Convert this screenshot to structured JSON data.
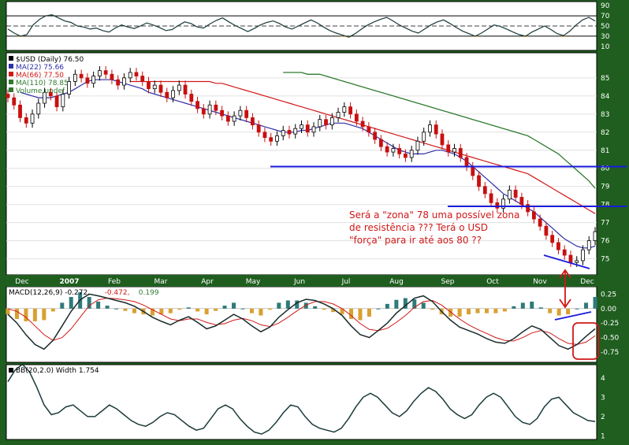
{
  "chart_data": [
    {
      "type": "line",
      "panel": "rsi",
      "y_ticks": [
        10,
        30,
        50,
        70,
        90
      ],
      "levels": [
        30,
        50,
        70
      ],
      "ylim": [
        5,
        95
      ],
      "series": [
        {
          "values": [
            44,
            36,
            30,
            33,
            52,
            63,
            70,
            72,
            66,
            60,
            57,
            50,
            48,
            44,
            46,
            41,
            38,
            46,
            52,
            48,
            45,
            50,
            56,
            52,
            47,
            41,
            43,
            51,
            58,
            55,
            48,
            46,
            54,
            61,
            66,
            58,
            51,
            45,
            39,
            45,
            52,
            57,
            60,
            55,
            48,
            44,
            50,
            56,
            62,
            56,
            48,
            41,
            36,
            32,
            28,
            35,
            44,
            52,
            58,
            63,
            67,
            60,
            52,
            46,
            40,
            36,
            44,
            52,
            58,
            62,
            55,
            47,
            40,
            35,
            30,
            36,
            44,
            52,
            49,
            44,
            38,
            33,
            30,
            38,
            44,
            50,
            43,
            35,
            31,
            40,
            52,
            62,
            67,
            60
          ]
        }
      ]
    },
    {
      "type": "candlestick",
      "panel": "price",
      "legend": [
        {
          "label": "$USD (Daily) 76.50",
          "color": "#000000"
        },
        {
          "label": "MA(22) 75.66",
          "color": "#2f2fa8"
        },
        {
          "label": "MA(66) 77.50",
          "color": "#d01818"
        },
        {
          "label": "MA(110) 78.85",
          "color": "#2f7a2f"
        },
        {
          "label": "Volume undef",
          "color": "#2f7a2f"
        }
      ],
      "y_ticks": [
        75,
        76,
        77,
        78,
        79,
        80,
        81,
        82,
        83,
        84,
        85
      ],
      "ylim": [
        74.2,
        86.3
      ],
      "x_labels": [
        "Dec",
        "2007",
        "Feb",
        "Mar",
        "Apr",
        "May",
        "Jun",
        "Jul",
        "Aug",
        "Sep",
        "Oct",
        "Nov",
        "Dec"
      ],
      "close": [
        83.9,
        83.5,
        82.8,
        82.5,
        83.0,
        83.6,
        84.2,
        84.0,
        83.4,
        84.1,
        84.8,
        85.2,
        85.0,
        84.7,
        85.1,
        85.4,
        85.2,
        84.9,
        84.6,
        85.0,
        85.3,
        85.1,
        84.8,
        84.4,
        84.6,
        84.2,
        83.9,
        84.3,
        84.6,
        84.1,
        83.7,
        83.3,
        83.0,
        83.5,
        83.2,
        82.9,
        82.6,
        82.9,
        83.2,
        82.8,
        82.4,
        82.0,
        81.7,
        81.5,
        81.8,
        82.1,
        81.9,
        82.2,
        82.4,
        82.0,
        82.3,
        82.7,
        82.4,
        82.8,
        83.1,
        83.4,
        83.0,
        82.6,
        82.3,
        82.0,
        81.6,
        81.2,
        80.9,
        81.1,
        80.8,
        80.6,
        81.0,
        81.5,
        82.0,
        82.4,
        81.9,
        81.3,
        80.9,
        81.1,
        80.6,
        80.1,
        79.6,
        79.0,
        78.6,
        78.1,
        77.8,
        78.3,
        78.8,
        78.4,
        78.0,
        77.6,
        77.2,
        76.8,
        76.3,
        75.9,
        75.5,
        75.2,
        74.8,
        74.9,
        75.5,
        76.0,
        76.5
      ],
      "ma_22": [
        84.2,
        84.1,
        84.0,
        83.9,
        83.9,
        83.9,
        84.0,
        84.1,
        84.2,
        84.4,
        84.6,
        84.8,
        84.9,
        84.9,
        84.9,
        84.9,
        84.8,
        84.7,
        84.6,
        84.5,
        84.4,
        84.2,
        84.1,
        84.0,
        83.9,
        83.8,
        83.7,
        83.6,
        83.5,
        83.4,
        83.3,
        83.2,
        83.1,
        83.0,
        82.9,
        82.8,
        82.7,
        82.6,
        82.5,
        82.4,
        82.3,
        82.2,
        82.1,
        82.0,
        82.0,
        82.0,
        82.1,
        82.1,
        82.2,
        82.3,
        82.4,
        82.5,
        82.5,
        82.5,
        82.4,
        82.3,
        82.2,
        82.0,
        81.8,
        81.6,
        81.4,
        81.2,
        81.0,
        80.9,
        80.8,
        80.8,
        80.8,
        80.9,
        81.0,
        81.0,
        80.9,
        80.8,
        80.6,
        80.4,
        80.1,
        79.8,
        79.5,
        79.2,
        78.9,
        78.6,
        78.4,
        78.2,
        78.0,
        77.8,
        77.6,
        77.3,
        77.0,
        76.7,
        76.4,
        76.1,
        75.9,
        75.7,
        75.6,
        75.6,
        75.7
      ],
      "ma_66": [
        84.8,
        84.8,
        84.8,
        84.8,
        84.8,
        84.8,
        84.8,
        84.8,
        84.8,
        84.8,
        84.8,
        84.8,
        84.8,
        84.8,
        84.7,
        84.7,
        84.6,
        84.5,
        84.4,
        84.3,
        84.2,
        84.1,
        84.0,
        83.9,
        83.8,
        83.7,
        83.6,
        83.5,
        83.4,
        83.3,
        83.2,
        83.1,
        83.0,
        82.9,
        82.8,
        82.7,
        82.6,
        82.5,
        82.4,
        82.3,
        82.2,
        82.1,
        82.0,
        81.9,
        81.8,
        81.7,
        81.6,
        81.5,
        81.4,
        81.3,
        81.2,
        81.1,
        81.0,
        80.9,
        80.8,
        80.7,
        80.6,
        80.5,
        80.4,
        80.3,
        80.2,
        80.1,
        80.0,
        79.9,
        79.8,
        79.7,
        79.5,
        79.3,
        79.1,
        78.9,
        78.7,
        78.5,
        78.3,
        78.1,
        77.9,
        77.7,
        77.5
      ],
      "ma_110": [
        85.3,
        85.3,
        85.3,
        85.3,
        85.2,
        85.2,
        85.2,
        85.1,
        85.0,
        84.9,
        84.8,
        84.7,
        84.6,
        84.5,
        84.4,
        84.3,
        84.2,
        84.1,
        84.0,
        83.9,
        83.8,
        83.7,
        83.6,
        83.5,
        83.4,
        83.3,
        83.2,
        83.1,
        83.0,
        82.9,
        82.8,
        82.7,
        82.6,
        82.5,
        82.4,
        82.3,
        82.2,
        82.1,
        82.0,
        81.9,
        81.8,
        81.6,
        81.4,
        81.2,
        81.0,
        80.8,
        80.5,
        80.2,
        79.9,
        79.6,
        79.3,
        78.9
      ],
      "support_resistance": [
        80.1,
        77.9
      ],
      "annotation": "Será a \"zona\" 78 uma possível zona\nde resistência ??? Terá o USD\n\"força\" para ir até aos 80 ??"
    },
    {
      "type": "line",
      "panel": "macd",
      "legend": [
        {
          "label": "MACD(12,26,9) -0.272,",
          "color": "#000000"
        },
        {
          "label": "-0.472,",
          "color": "#d01818"
        },
        {
          "label": "0.199",
          "color": "#2f7a2f"
        }
      ],
      "y_ticks": [
        "0.25",
        "0.00",
        "-0.25",
        "-0.50",
        "-0.75"
      ],
      "ylim": [
        -0.9,
        0.35
      ],
      "macd": [
        -0.1,
        -0.25,
        -0.45,
        -0.62,
        -0.7,
        -0.55,
        -0.3,
        -0.05,
        0.15,
        0.25,
        0.22,
        0.18,
        0.14,
        0.1,
        0.04,
        -0.05,
        -0.15,
        -0.22,
        -0.28,
        -0.2,
        -0.14,
        -0.24,
        -0.35,
        -0.3,
        -0.2,
        -0.1,
        -0.18,
        -0.3,
        -0.4,
        -0.32,
        -0.15,
        -0.02,
        0.1,
        0.16,
        0.14,
        0.08,
        0.0,
        -0.12,
        -0.3,
        -0.45,
        -0.5,
        -0.38,
        -0.25,
        -0.08,
        0.05,
        0.18,
        0.22,
        0.12,
        -0.05,
        -0.2,
        -0.32,
        -0.38,
        -0.44,
        -0.52,
        -0.58,
        -0.6,
        -0.52,
        -0.4,
        -0.3,
        -0.36,
        -0.5,
        -0.64,
        -0.7,
        -0.62,
        -0.48,
        -0.35
      ],
      "signal": [
        0.0,
        -0.05,
        -0.15,
        -0.3,
        -0.45,
        -0.55,
        -0.5,
        -0.35,
        -0.15,
        0.05,
        0.15,
        0.18,
        0.17,
        0.15,
        0.12,
        0.06,
        -0.02,
        -0.1,
        -0.18,
        -0.21,
        -0.18,
        -0.18,
        -0.24,
        -0.28,
        -0.26,
        -0.2,
        -0.17,
        -0.21,
        -0.28,
        -0.31,
        -0.25,
        -0.15,
        -0.04,
        0.06,
        0.12,
        0.12,
        0.08,
        0.0,
        -0.12,
        -0.26,
        -0.36,
        -0.38,
        -0.34,
        -0.24,
        -0.12,
        0.02,
        0.12,
        0.14,
        0.06,
        -0.06,
        -0.18,
        -0.28,
        -0.36,
        -0.43,
        -0.5,
        -0.55,
        -0.56,
        -0.5,
        -0.42,
        -0.38,
        -0.42,
        -0.52,
        -0.6,
        -0.62,
        -0.58,
        -0.47
      ],
      "hist": [
        -0.1,
        -0.18,
        -0.22,
        -0.22,
        -0.2,
        -0.05,
        0.1,
        0.2,
        0.28,
        0.2,
        0.12,
        0.05,
        0.0,
        -0.04,
        -0.08,
        -0.1,
        -0.12,
        -0.1,
        -0.08,
        -0.02,
        0.02,
        -0.05,
        -0.1,
        -0.04,
        0.05,
        0.1,
        0.0,
        -0.08,
        -0.12,
        -0.02,
        0.1,
        0.14,
        0.14,
        0.1,
        0.04,
        -0.02,
        -0.06,
        -0.1,
        -0.18,
        -0.2,
        -0.14,
        0.0,
        0.08,
        0.15,
        0.18,
        0.16,
        0.1,
        -0.02,
        -0.1,
        -0.14,
        -0.14,
        -0.1,
        -0.08,
        -0.08,
        -0.08,
        -0.05,
        0.04,
        0.1,
        0.12,
        0.02,
        -0.08,
        -0.12,
        -0.1,
        0.0,
        0.1,
        0.2
      ]
    },
    {
      "type": "line",
      "panel": "bb_width",
      "legend": [
        {
          "label": "BB(20,2.0) Width 1.754",
          "color": "#000000"
        }
      ],
      "y_ticks": [
        1,
        2,
        3,
        4
      ],
      "ylim": [
        0.9,
        4.6
      ],
      "series": [
        {
          "values": [
            3.8,
            4.4,
            4.7,
            4.3,
            3.5,
            2.6,
            2.1,
            2.2,
            2.5,
            2.6,
            2.3,
            2.0,
            2.0,
            2.3,
            2.6,
            2.4,
            2.1,
            1.8,
            1.6,
            1.5,
            1.7,
            2.0,
            2.2,
            2.1,
            1.8,
            1.5,
            1.3,
            1.4,
            1.9,
            2.4,
            2.6,
            2.4,
            1.9,
            1.5,
            1.2,
            1.1,
            1.3,
            1.7,
            2.2,
            2.6,
            2.5,
            2.0,
            1.6,
            1.4,
            1.3,
            1.2,
            1.4,
            1.9,
            2.5,
            3.0,
            3.2,
            3.0,
            2.6,
            2.2,
            2.0,
            2.3,
            2.8,
            3.2,
            3.5,
            3.3,
            2.9,
            2.4,
            2.1,
            1.9,
            2.1,
            2.6,
            3.0,
            3.2,
            3.0,
            2.5,
            2.0,
            1.7,
            1.6,
            1.9,
            2.5,
            2.9,
            3.0,
            2.6,
            2.2,
            2.0,
            1.8,
            1.75
          ]
        }
      ]
    }
  ]
}
